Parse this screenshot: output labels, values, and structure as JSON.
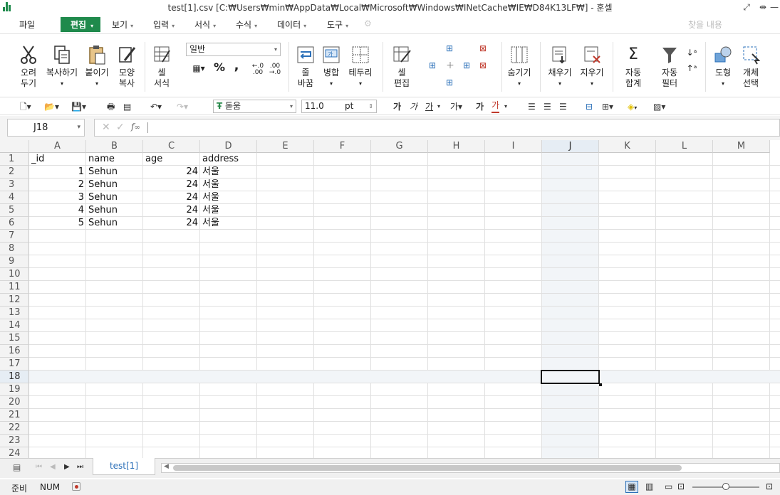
{
  "window": {
    "title": "test[1].csv [C:₩Users₩min₩AppData₩Local₩Microsoft₩Windows₩INetCache₩IE₩D84K13LF₩] - 훈셀"
  },
  "menu": {
    "file": "파일",
    "edit": "편집",
    "view": "보기",
    "input": "입력",
    "format": "서식",
    "formula": "수식",
    "data": "데이터",
    "tools": "도구",
    "find_placeholder": "찾을 내용"
  },
  "ribbon": {
    "cut": [
      "오려",
      "두기"
    ],
    "copy": "복사하기",
    "paste": "붙이기",
    "format_painter": [
      "모양",
      "복사"
    ],
    "cell_format": [
      "셀",
      "서식"
    ],
    "number_format": "일반",
    "wrap": [
      "줄",
      "바꿈"
    ],
    "merge": "병합",
    "border": "테두리",
    "cell_edit": [
      "셀",
      "편집"
    ],
    "hide": "숨기기",
    "fill": "채우기",
    "clear": "지우기",
    "autosum": [
      "자동",
      "합계"
    ],
    "autofilter": [
      "자동",
      "필터"
    ],
    "shapes": "도형",
    "select_object": [
      "개체",
      "선택"
    ]
  },
  "toolbar": {
    "font_name": "돋움",
    "font_size": "11.0",
    "font_unit": "pt",
    "bold": "가",
    "italic": "가",
    "underline": "가",
    "font_color": "가"
  },
  "formula_bar": {
    "cell_ref": "J18",
    "fx": "f(x)",
    "value": ""
  },
  "columns": [
    "A",
    "B",
    "C",
    "D",
    "E",
    "F",
    "G",
    "H",
    "I",
    "J",
    "K",
    "L",
    "M"
  ],
  "rows": [
    "1",
    "2",
    "3",
    "4",
    "5",
    "6",
    "7",
    "8",
    "9",
    "10",
    "11",
    "12",
    "13",
    "14",
    "15",
    "16",
    "17",
    "18",
    "19",
    "20",
    "21",
    "22",
    "23",
    "24"
  ],
  "table": {
    "header": [
      "_id",
      "name",
      "age",
      "address"
    ],
    "rows": [
      [
        "1",
        "Sehun",
        "24",
        "서울"
      ],
      [
        "2",
        "Sehun",
        "24",
        "서울"
      ],
      [
        "3",
        "Sehun",
        "24",
        "서울"
      ],
      [
        "4",
        "Sehun",
        "24",
        "서울"
      ],
      [
        "5",
        "Sehun",
        "24",
        "서울"
      ]
    ]
  },
  "active_cell": {
    "column": "J",
    "row": "18"
  },
  "sheet_tabs": [
    "test[1]"
  ],
  "status": {
    "ready": "준비",
    "num": "NUM"
  },
  "colors": {
    "accent": "#1f8a4c",
    "selection": "#e6edf4"
  }
}
